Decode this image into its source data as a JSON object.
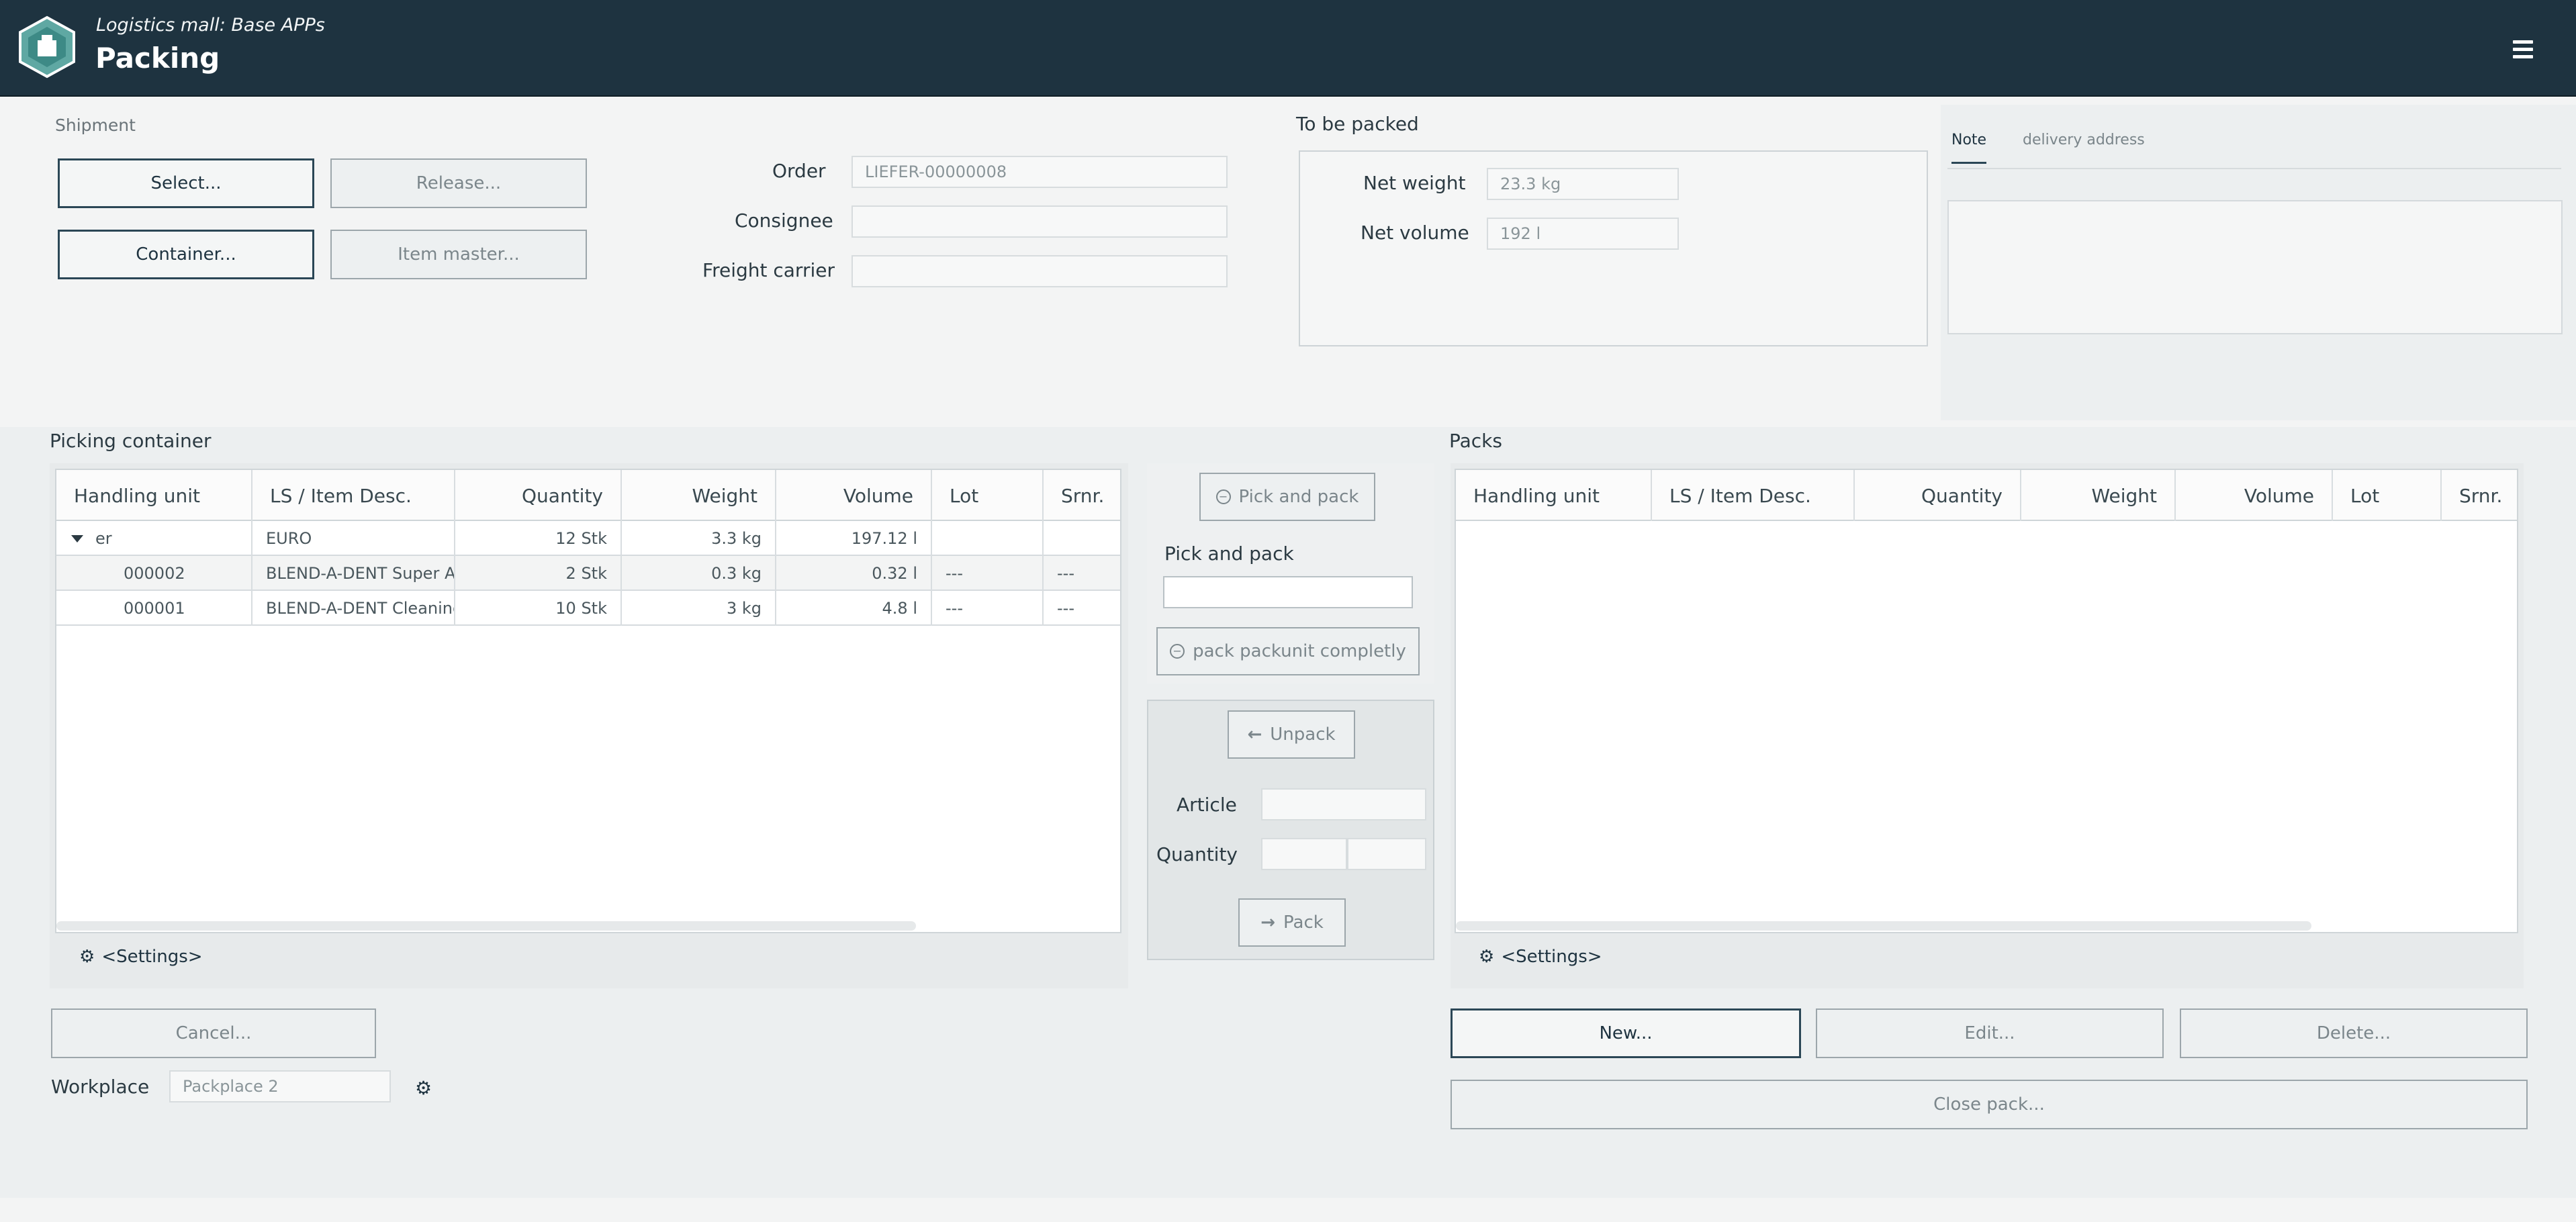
{
  "header": {
    "subtitle": "Logistics mall: Base APPs",
    "title": "Packing"
  },
  "shipment": {
    "label": "Shipment",
    "select_btn": "Select...",
    "release_btn": "Release...",
    "container_btn": "Container...",
    "item_master_btn": "Item master...",
    "order_label": "Order",
    "order_value": "LIEFER-00000008",
    "consignee_label": "Consignee",
    "consignee_value": "",
    "freight_label": "Freight carrier",
    "freight_value": ""
  },
  "to_be_packed": {
    "label": "To be packed",
    "net_weight_label": "Net weight",
    "net_weight_value": "23.3 kg",
    "net_volume_label": "Net volume",
    "net_volume_value": "192 l"
  },
  "note_tabs": {
    "note": "Note",
    "delivery": "delivery address"
  },
  "picking": {
    "title": "Picking container",
    "columns": [
      "Handling unit",
      "LS / Item Desc.",
      "Quantity",
      "Weight",
      "Volume",
      "Lot",
      "Srnr."
    ],
    "rows": [
      {
        "hu": "er",
        "desc": "EURO",
        "qty": "12 Stk",
        "weight": "3.3 kg",
        "volume": "197.12 l",
        "lot": "",
        "srnr": ""
      },
      {
        "hu": "000002",
        "desc": "BLEND-A-DENT Super Adhesive",
        "qty": "2 Stk",
        "weight": "0.3 kg",
        "volume": "0.32 l",
        "lot": "---",
        "srnr": "---"
      },
      {
        "hu": "000001",
        "desc": "BLEND-A-DENT Cleaning",
        "qty": "10 Stk",
        "weight": "3 kg",
        "volume": "4.8 l",
        "lot": "---",
        "srnr": "---"
      }
    ],
    "settings": "<Settings>"
  },
  "center": {
    "pick_pack_btn": "Pick and pack",
    "pick_pack_label": "Pick and pack",
    "pick_pack_value": "",
    "pack_complete_btn": "pack packunit completly",
    "unpack_btn": "Unpack",
    "article_label": "Article",
    "article_value": "",
    "quantity_label": "Quantity",
    "pack_btn": "Pack"
  },
  "packs": {
    "title": "Packs",
    "columns": [
      "Handling unit",
      "LS / Item Desc.",
      "Quantity",
      "Weight",
      "Volume",
      "Lot",
      "Srnr."
    ],
    "settings": "<Settings>",
    "new_btn": "New...",
    "edit_btn": "Edit...",
    "delete_btn": "Delete...",
    "close_btn": "Close pack..."
  },
  "footer": {
    "cancel_btn": "Cancel...",
    "workplace_label": "Workplace",
    "workplace_value": "Packplace 2"
  },
  "colors": {
    "header_bg": "#1e3340",
    "accent": "#2b4756",
    "logo": "#5fa8a3"
  }
}
